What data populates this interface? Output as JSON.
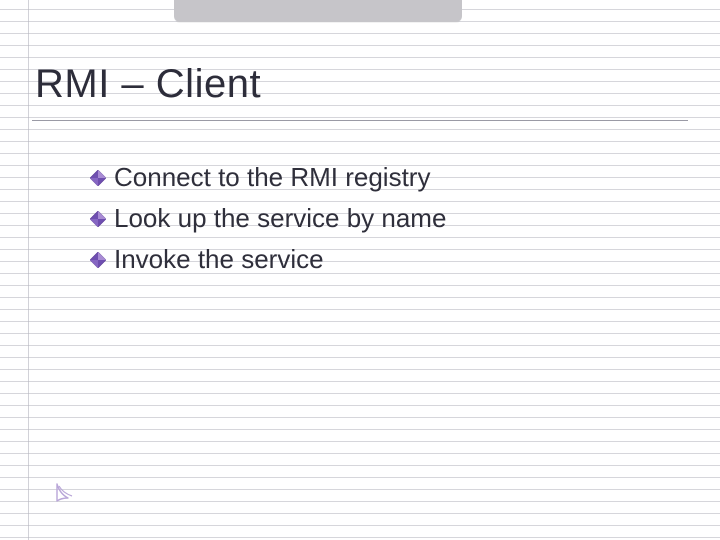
{
  "slide": {
    "title": "RMI – Client",
    "bullets": [
      "Connect to the RMI registry",
      "Look up the service by name",
      "Invoke the service"
    ]
  },
  "icons": {
    "bullet": "diamond-bullet-icon",
    "tail": "corner-mark-icon"
  },
  "colors": {
    "bullet_outline": "#5b3a96",
    "bullet_fill1": "#a88bd4",
    "bullet_fill2": "#6f4fb0",
    "text": "#2f2f3b",
    "topbar": "#c6c5c9",
    "underline": "#9a9aa5",
    "tail": "#b9a6d8"
  }
}
